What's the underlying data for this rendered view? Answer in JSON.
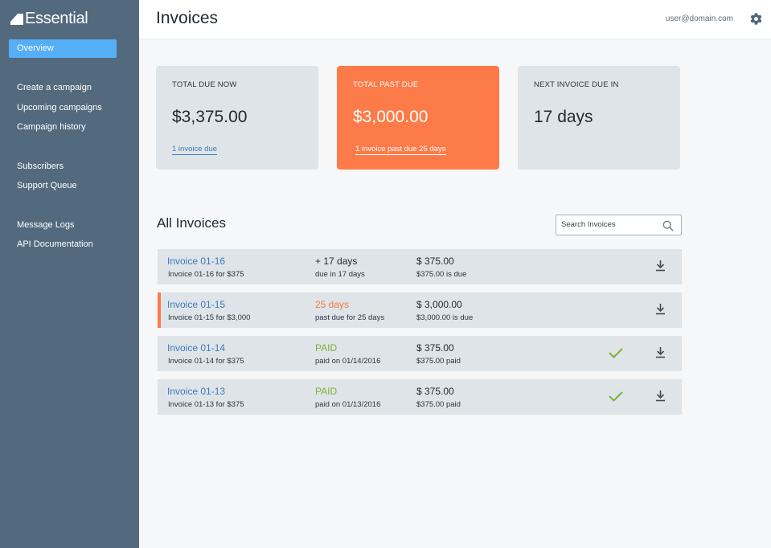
{
  "app": {
    "name": "Essential"
  },
  "sidebar": {
    "active": "Overview",
    "groups": [
      [
        "Create a campaign",
        "Upcoming campaigns",
        "Campaign history"
      ],
      [
        "Subscribers",
        "Support Queue"
      ],
      [
        "Message Logs",
        "API Documentation"
      ]
    ]
  },
  "header": {
    "title": "Invoices",
    "user": "user@domain.com"
  },
  "cards": [
    {
      "label": "TOTAL DUE NOW",
      "value": "$3,375.00",
      "link": "1 invoice due"
    },
    {
      "label": "TOTAL PAST DUE",
      "value": "$3,000.00",
      "link": "1 invoice past due 25 days"
    },
    {
      "label": "NEXT INVOICE DUE IN",
      "value": "17 days"
    }
  ],
  "invoices_section": {
    "title": "All Invoices",
    "search_placeholder": "Search Invoices"
  },
  "invoices": [
    {
      "title": "Invoice 01-16",
      "subtitle": "Invoice 01-16 for $375",
      "status": "+ 17 days",
      "status_sub": "due in 17 days",
      "amount": "$ 375.00",
      "amount_sub": "$375.00 is due"
    },
    {
      "title": "Invoice 01-15",
      "subtitle": "Invoice 01-15 for $3,000",
      "status": "25 days",
      "status_sub": "past due for 25 days",
      "amount": "$ 3,000.00",
      "amount_sub": "$3,000.00 is due"
    },
    {
      "title": "Invoice 01-14",
      "subtitle": "Invoice 01-14 for $375",
      "status": "PAID",
      "status_sub": "paid on 01/14/2016",
      "amount": "$ 375.00",
      "amount_sub": "$375.00 paid"
    },
    {
      "title": "Invoice 01-13",
      "subtitle": "Invoice 01-13 for $375",
      "status": "PAID",
      "status_sub": "paid on 01/13/2016",
      "amount": "$ 375.00",
      "amount_sub": "$375.00 paid"
    }
  ],
  "colors": {
    "sidebar": "#536a7e",
    "active_nav": "#55aef6",
    "past_due": "#fd7b48",
    "paid": "#7ab33a",
    "link": "#3a7bbd"
  },
  "icons": [
    "logo-icon",
    "gear-icon",
    "search-icon",
    "download-icon",
    "check-icon"
  ]
}
